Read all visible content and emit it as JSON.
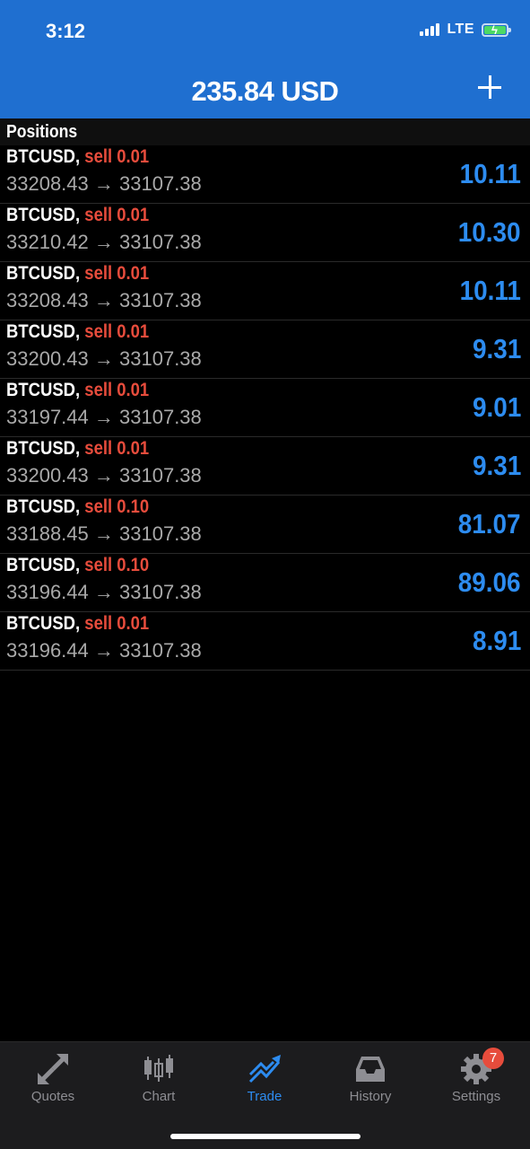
{
  "status_bar": {
    "time": "3:12",
    "network": "LTE"
  },
  "header": {
    "balance": "235.84 USD"
  },
  "section": {
    "title": "Positions"
  },
  "positions": [
    {
      "symbol": "BTCUSD,",
      "side": "sell 0.01",
      "open": "33208.43",
      "arrow": "→",
      "current": "33107.38",
      "profit": "10.11"
    },
    {
      "symbol": "BTCUSD,",
      "side": "sell 0.01",
      "open": "33210.42",
      "arrow": "→",
      "current": "33107.38",
      "profit": "10.30"
    },
    {
      "symbol": "BTCUSD,",
      "side": "sell 0.01",
      "open": "33208.43",
      "arrow": "→",
      "current": "33107.38",
      "profit": "10.11"
    },
    {
      "symbol": "BTCUSD,",
      "side": "sell 0.01",
      "open": "33200.43",
      "arrow": "→",
      "current": "33107.38",
      "profit": "9.31"
    },
    {
      "symbol": "BTCUSD,",
      "side": "sell 0.01",
      "open": "33197.44",
      "arrow": "→",
      "current": "33107.38",
      "profit": "9.01"
    },
    {
      "symbol": "BTCUSD,",
      "side": "sell 0.01",
      "open": "33200.43",
      "arrow": "→",
      "current": "33107.38",
      "profit": "9.31"
    },
    {
      "symbol": "BTCUSD,",
      "side": "sell 0.10",
      "open": "33188.45",
      "arrow": "→",
      "current": "33107.38",
      "profit": "81.07"
    },
    {
      "symbol": "BTCUSD,",
      "side": "sell 0.10",
      "open": "33196.44",
      "arrow": "→",
      "current": "33107.38",
      "profit": "89.06"
    },
    {
      "symbol": "BTCUSD,",
      "side": "sell 0.01",
      "open": "33196.44",
      "arrow": "→",
      "current": "33107.38",
      "profit": "8.91"
    }
  ],
  "tabs": {
    "quotes": "Quotes",
    "chart": "Chart",
    "trade": "Trade",
    "history": "History",
    "settings": "Settings",
    "settings_badge": "7"
  },
  "colors": {
    "header_bg": "#1f6fd0",
    "sell": "#e74c3c",
    "profit": "#2d8cf0",
    "active_tab": "#2d8cf0"
  },
  "icons": {
    "quotes": "arrows-diagonal-icon",
    "chart": "candlestick-icon",
    "trade": "trend-up-icon",
    "history": "inbox-tray-icon",
    "settings": "gear-icon"
  }
}
